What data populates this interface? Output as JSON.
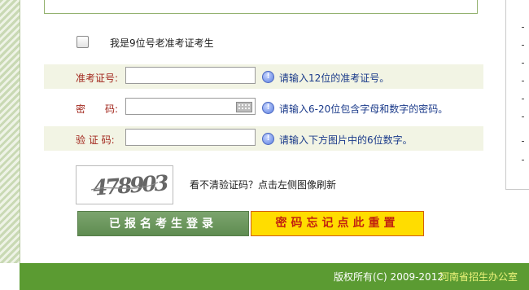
{
  "returning_candidate": {
    "label": "我是9位号老准考证考生"
  },
  "form": {
    "rows": [
      {
        "label": "准考证号:",
        "value": "",
        "hint": "请输入12位的准考证号。"
      },
      {
        "label": "密　　码:",
        "value": "",
        "hint": "请输入6-20位包含字母和数字的密码。"
      },
      {
        "label": "验 证 码:",
        "value": "",
        "hint": "请输入下方图片中的6位数字。"
      }
    ]
  },
  "captcha": {
    "text": "478903",
    "refresh_label": "看不清验证码？点击左侧图像刷新"
  },
  "buttons": {
    "login": "已报名考生登录",
    "reset": "密码忘记点此重置"
  },
  "footer": {
    "copyright": "版权所有(C) 2009-2012",
    "office": "河南省招生办公室"
  },
  "colors": {
    "label_red": "#a1251b",
    "footer_green": "#5b9b32",
    "login_green": "#6a9a5c",
    "reset_yellow": "#ffdd00"
  }
}
